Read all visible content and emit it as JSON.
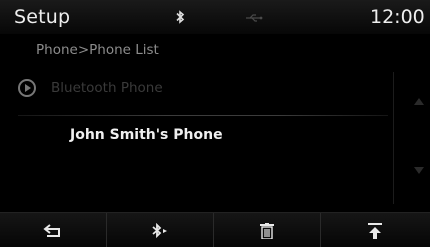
{
  "header": {
    "title": "Setup",
    "clock": "12:00",
    "status_icons": [
      "bluetooth-icon",
      "usb-icon"
    ]
  },
  "breadcrumb": "Phone>Phone List",
  "list": {
    "bluetooth_row": {
      "icon": "play-circle-icon",
      "label": "Bluetooth Phone"
    },
    "phones": [
      {
        "label": "John Smith's Phone"
      }
    ]
  },
  "scrollbar": {
    "up_icon": "arrow-up-icon",
    "down_icon": "arrow-down-icon"
  },
  "toolbar": {
    "buttons": [
      {
        "icon": "back-icon"
      },
      {
        "icon": "bluetooth-connect-icon"
      },
      {
        "icon": "trash-icon"
      },
      {
        "icon": "move-to-top-icon"
      }
    ]
  },
  "colors": {
    "background": "#000000",
    "text_primary": "#f0f0f0",
    "text_secondary": "#8c8c8c",
    "text_disabled": "#3a3a3a"
  }
}
